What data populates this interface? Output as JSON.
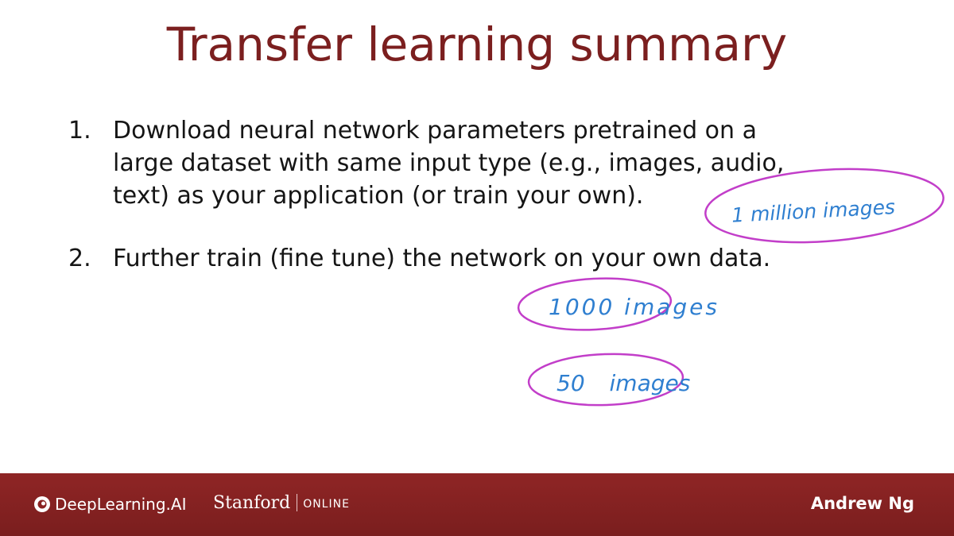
{
  "slide": {
    "title": "Transfer learning summary",
    "items": [
      {
        "number": "1.",
        "lines": [
          "Download neural network parameters pretrained on a",
          "large dataset with same input type (e.g., images, audio,",
          "text) as your application (or train your own)."
        ]
      },
      {
        "number": "2.",
        "lines": [
          "Further train (fine tune) the network on your own data."
        ]
      }
    ]
  },
  "annotations": {
    "note_1": "1 million images",
    "note_2": "1000 images",
    "note_3": "50 images",
    "ink_color": "#2f7fd0",
    "circle_color": "#c23ec9"
  },
  "footer": {
    "logo_deeplearning": "DeepLearning.AI",
    "logo_stanford": "Stanford",
    "logo_online": "ONLINE",
    "author": "Andrew Ng",
    "background_color": "#8a2323"
  }
}
